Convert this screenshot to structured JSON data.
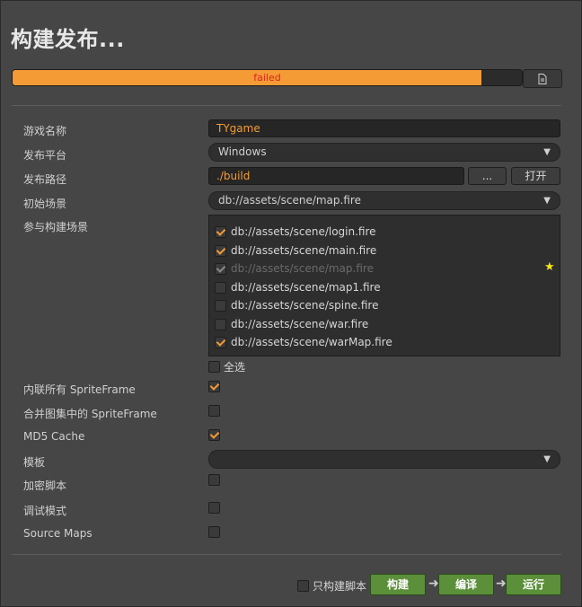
{
  "window": {
    "title": "构建发布..."
  },
  "progress": {
    "status_text": "failed",
    "percent": 92,
    "log_icon": "document-icon"
  },
  "form": {
    "game_name": {
      "label": "游戏名称",
      "value": "TYgame"
    },
    "platform": {
      "label": "发布平台",
      "value": "Windows"
    },
    "build_path": {
      "label": "发布路径",
      "value": "./build",
      "browse_label": "...",
      "open_label": "打开"
    },
    "start_scene": {
      "label": "初始场景",
      "value": "db://assets/scene/map.fire"
    },
    "included_scenes": {
      "label": "参与构建场景",
      "items": [
        {
          "path": "db://assets/scene/login.fire",
          "checked": true,
          "disabled": false
        },
        {
          "path": "db://assets/scene/main.fire",
          "checked": true,
          "disabled": false
        },
        {
          "path": "db://assets/scene/map.fire",
          "checked": true,
          "disabled": true
        },
        {
          "path": "db://assets/scene/map1.fire",
          "checked": false,
          "disabled": false
        },
        {
          "path": "db://assets/scene/spine.fire",
          "checked": false,
          "disabled": false
        },
        {
          "path": "db://assets/scene/war.fire",
          "checked": false,
          "disabled": false
        },
        {
          "path": "db://assets/scene/warMap.fire",
          "checked": true,
          "disabled": false
        }
      ],
      "select_all_label": "全选",
      "select_all_checked": false
    },
    "inline_spriteframe": {
      "label": "内联所有 SpriteFrame",
      "checked": true
    },
    "merge_spriteframe": {
      "label": "合并图集中的 SpriteFrame",
      "checked": false
    },
    "md5_cache": {
      "label": "MD5 Cache",
      "checked": true
    },
    "template": {
      "label": "模板",
      "value": ""
    },
    "encrypt_scripts": {
      "label": "加密脚本",
      "checked": false
    },
    "debug_mode": {
      "label": "调试模式",
      "checked": false
    },
    "source_maps": {
      "label": "Source Maps",
      "checked": false
    }
  },
  "footer": {
    "build_scripts_only_label": "只构建脚本",
    "build_scripts_only_checked": false,
    "build_label": "构建",
    "compile_label": "编译",
    "run_label": "运行"
  },
  "colors": {
    "accent": "#f49b36",
    "error_text": "#e02020",
    "action_green": "#5b8f3a",
    "star": "#f6e515"
  }
}
